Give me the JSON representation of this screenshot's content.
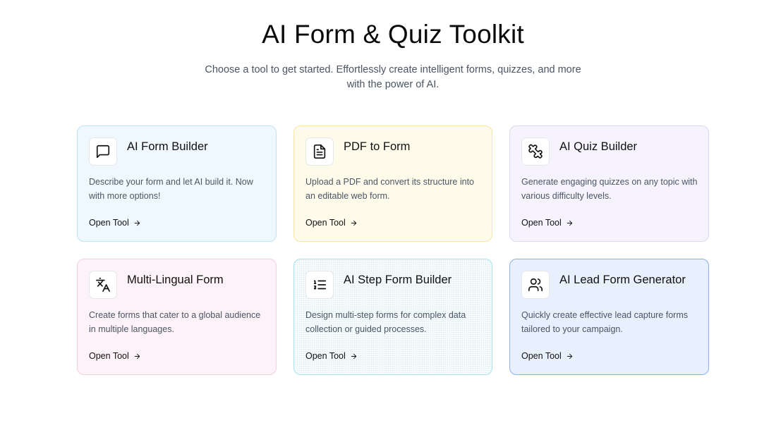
{
  "header": {
    "title": "AI Form & Quiz Toolkit",
    "subtitle": "Choose a tool to get started. Effortlessly create intelligent forms, quizzes, and more with the power of AI."
  },
  "tools": [
    {
      "title": "AI Form Builder",
      "description": "Describe your form and let AI build it. Now with more options!",
      "link_label": "Open Tool",
      "icon": "message-square-icon",
      "accent": "#f0f8ff"
    },
    {
      "title": "PDF to Form",
      "description": "Upload a PDF and convert its structure into an editable web form.",
      "link_label": "Open Tool",
      "icon": "file-text-icon",
      "accent": "#fffbeb"
    },
    {
      "title": "AI Quiz Builder",
      "description": "Generate engaging quizzes on any topic with various difficulty levels.",
      "link_label": "Open Tool",
      "icon": "puzzle-icon",
      "accent": "#f6f3ff"
    },
    {
      "title": "Multi-Lingual Form",
      "description": "Create forms that cater to a global audience in multiple languages.",
      "link_label": "Open Tool",
      "icon": "languages-icon",
      "accent": "#fdf2f8"
    },
    {
      "title": "AI Step Form Builder",
      "description": "Design multi-step forms for complex data collection or guided processes.",
      "link_label": "Open Tool",
      "icon": "list-ordered-icon",
      "accent": "#f4fbfd"
    },
    {
      "title": "AI Lead Form Generator",
      "description": "Quickly create effective lead capture forms tailored to your campaign.",
      "link_label": "Open Tool",
      "icon": "users-icon",
      "accent": "#e8f0fe"
    }
  ]
}
